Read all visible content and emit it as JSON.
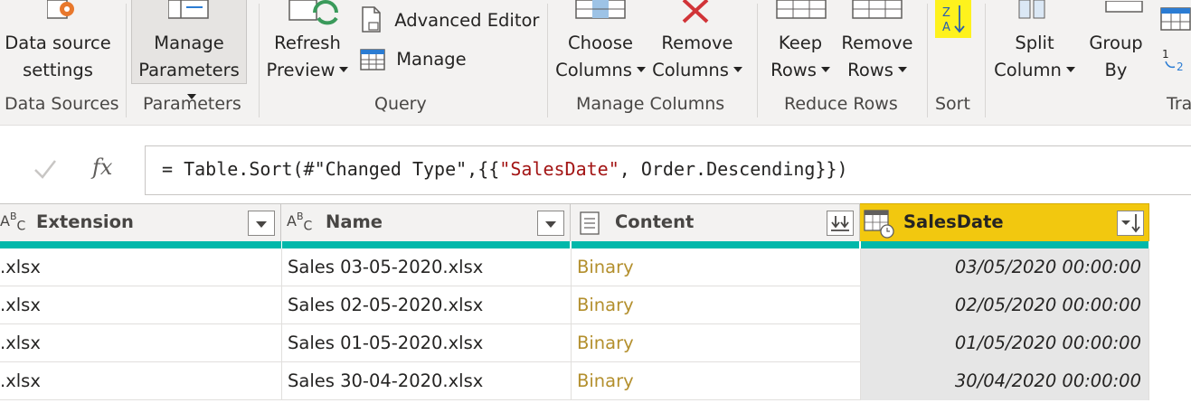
{
  "ribbon": {
    "data_sources": {
      "line1": "Data source",
      "line2": "settings",
      "group": "Data Sources"
    },
    "parameters": {
      "line1": "Manage",
      "line2": "Parameters",
      "group": "Parameters"
    },
    "query": {
      "refresh_line1": "Refresh",
      "refresh_line2": "Preview",
      "advanced_editor": "Advanced Editor",
      "manage": "Manage",
      "group": "Query"
    },
    "manage_columns": {
      "choose_line1": "Choose",
      "choose_line2": "Columns",
      "remove_line1": "Remove",
      "remove_line2": "Columns",
      "group": "Manage Columns"
    },
    "reduce_rows": {
      "keep_line1": "Keep",
      "keep_line2": "Rows",
      "remove_line1": "Remove",
      "remove_line2": "Rows",
      "group": "Reduce Rows"
    },
    "sort": {
      "group": "Sort"
    },
    "transform": {
      "split_line1": "Split",
      "split_line2": "Column",
      "group_line1": "Group",
      "group_line2": "By",
      "group": "Tra"
    }
  },
  "formula": {
    "prefix": "= Table.Sort(#\"Changed Type\",{{",
    "string": "\"SalesDate\"",
    "suffix": ", Order.Descending}})",
    "fx": "fx"
  },
  "columns": [
    {
      "name": "Extension",
      "type_icon": "ABC"
    },
    {
      "name": "Name",
      "type_icon": "ABC"
    },
    {
      "name": "Content",
      "type_icon": "binary"
    },
    {
      "name": "SalesDate",
      "type_icon": "datetime"
    }
  ],
  "rows": [
    {
      "extension": ".xlsx",
      "name": "Sales 03-05-2020.xlsx",
      "content": "Binary",
      "salesdate": "03/05/2020 00:00:00"
    },
    {
      "extension": ".xlsx",
      "name": "Sales 02-05-2020.xlsx",
      "content": "Binary",
      "salesdate": "02/05/2020 00:00:00"
    },
    {
      "extension": ".xlsx",
      "name": "Sales 01-05-2020.xlsx",
      "content": "Binary",
      "salesdate": "01/05/2020 00:00:00"
    },
    {
      "extension": ".xlsx",
      "name": "Sales 30-04-2020.xlsx",
      "content": "Binary",
      "salesdate": "30/04/2020 00:00:00"
    }
  ],
  "colors": {
    "accent": "#f2c80f",
    "quality_bar": "#01b8aa",
    "binary_text": "#b38f2d",
    "string_literal": "#a31515"
  }
}
